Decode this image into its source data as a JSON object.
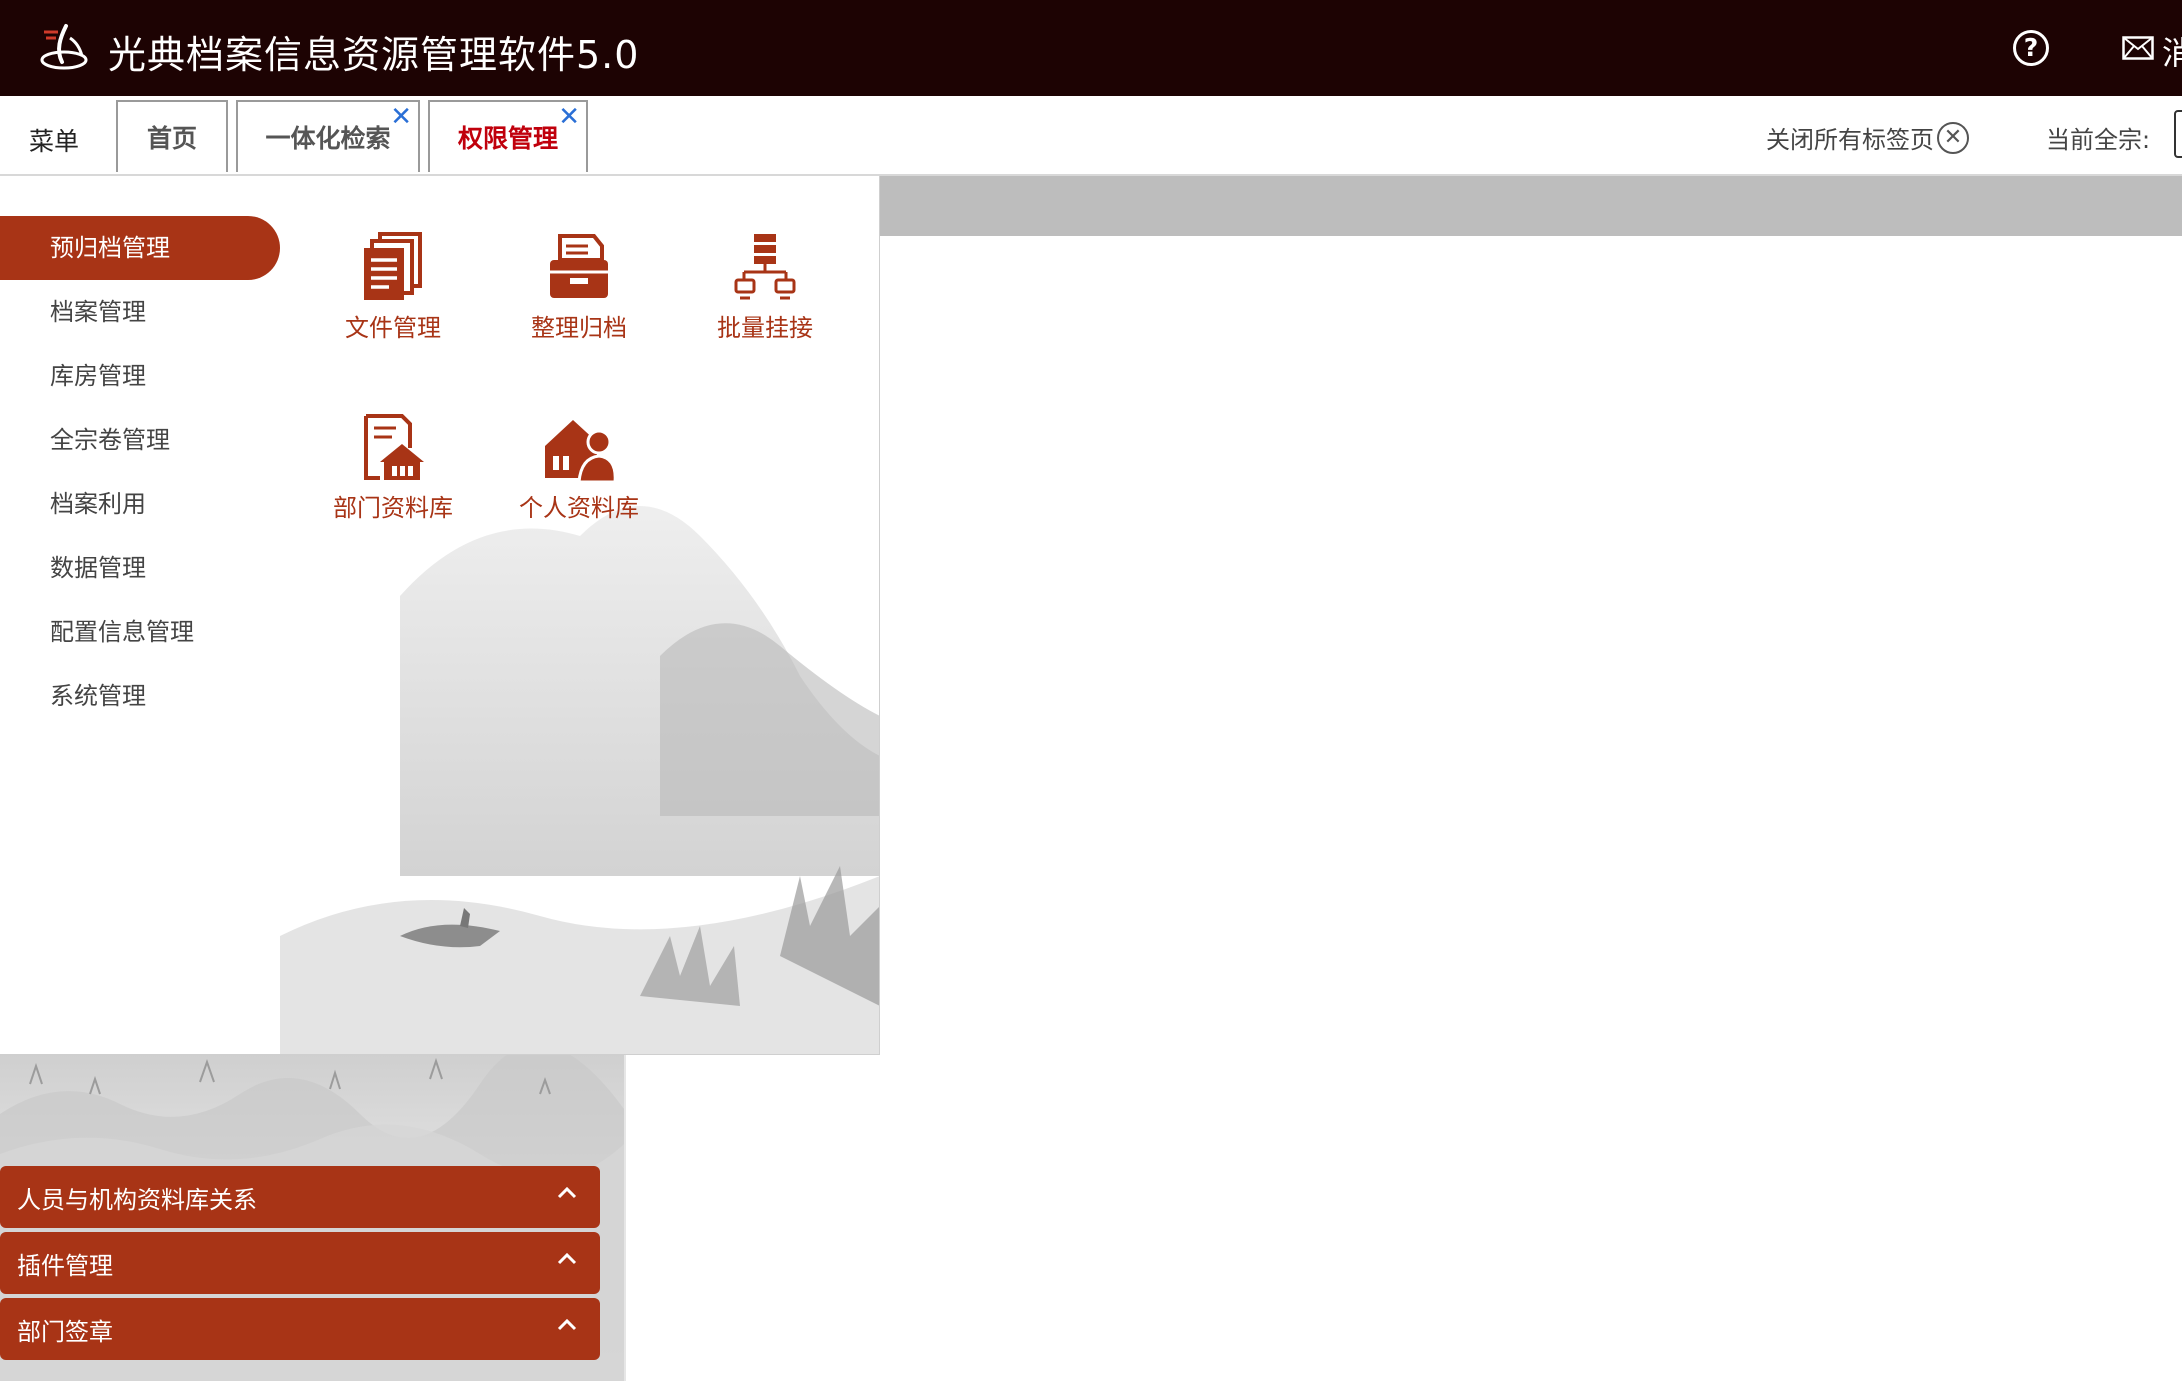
{
  "header": {
    "title": "光典档案信息资源管理软件5.0",
    "help_icon": "question-circle-icon",
    "mail_icon": "mail-icon",
    "mail_label_partial": "消"
  },
  "tabbar": {
    "menu_label": "菜单",
    "tabs": [
      {
        "label": "首页",
        "closable": false,
        "active": false
      },
      {
        "label": "一体化检索",
        "closable": true,
        "active": false
      },
      {
        "label": "权限管理",
        "closable": true,
        "active": true
      }
    ],
    "close_all_label": "关闭所有标签页",
    "current_fonds_label": "当前全宗:"
  },
  "menu": {
    "categories": [
      {
        "label": "预归档管理",
        "active": true
      },
      {
        "label": "档案管理",
        "active": false
      },
      {
        "label": "库房管理",
        "active": false
      },
      {
        "label": "全宗卷管理",
        "active": false
      },
      {
        "label": "档案利用",
        "active": false
      },
      {
        "label": "数据管理",
        "active": false
      },
      {
        "label": "配置信息管理",
        "active": false
      },
      {
        "label": "系统管理",
        "active": false
      }
    ],
    "functions": [
      {
        "label": "文件管理",
        "icon": "documents-icon"
      },
      {
        "label": "整理归档",
        "icon": "file-drawer-icon"
      },
      {
        "label": "批量挂接",
        "icon": "network-icon"
      },
      {
        "label": "部门资料库",
        "icon": "department-library-icon"
      },
      {
        "label": "个人资料库",
        "icon": "personal-library-icon"
      }
    ]
  },
  "sidebar_accordion": [
    {
      "label": "人员与机构资料库关系"
    },
    {
      "label": "插件管理"
    },
    {
      "label": "部门签章"
    }
  ],
  "colors": {
    "header_bg": "#1d0303",
    "accent": "#a83416",
    "active_tab_text": "#c0000c",
    "tab_close": "#2a6fd6"
  }
}
